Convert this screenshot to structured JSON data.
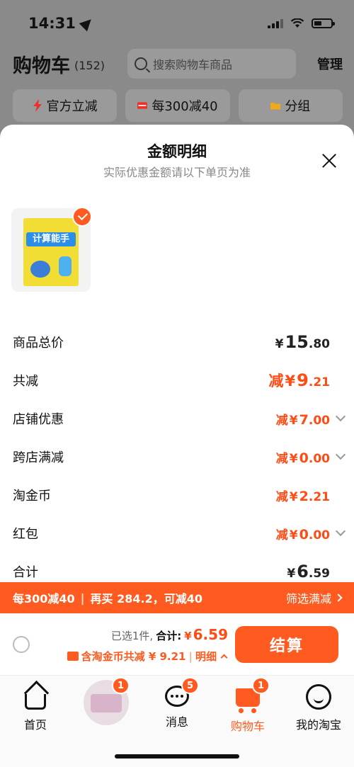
{
  "status": {
    "time": "14:31"
  },
  "header": {
    "title": "购物车",
    "count": "(152)",
    "search_placeholder": "搜索购物车商品",
    "manage": "管理"
  },
  "chips": [
    {
      "icon": "lightning-icon",
      "label": "官方立减",
      "color": "#e8322a"
    },
    {
      "icon": "coupon-icon",
      "label": "每300减40",
      "color": "#e8322a"
    },
    {
      "icon": "folder-icon",
      "label": "分组",
      "color": "#f2a818"
    }
  ],
  "sheet": {
    "title": "金额明细",
    "subtitle": "实际优惠金额请以下单页为准",
    "product_cover_text": "计算能手",
    "rows": [
      {
        "label": "商品总价",
        "prefix": "",
        "yen": "¥",
        "int": "15",
        "dec": ".80",
        "style": "dark",
        "chevron": false
      },
      {
        "label": "共减",
        "prefix": "减",
        "yen": "¥",
        "int": "9",
        "dec": ".21",
        "style": "orange",
        "chevron": false
      },
      {
        "label": "店铺优惠",
        "prefix": "减",
        "yen": "¥",
        "int": "7",
        "dec": ".00",
        "style": "orange-small",
        "chevron": true
      },
      {
        "label": "跨店满减",
        "prefix": "减",
        "yen": "¥",
        "int": "0",
        "dec": ".00",
        "style": "orange-small",
        "chevron": true
      },
      {
        "label": "淘金币",
        "prefix": "减",
        "yen": "¥",
        "int": "2",
        "dec": ".21",
        "style": "orange-small",
        "chevron": false
      },
      {
        "label": "红包",
        "prefix": "减",
        "yen": "¥",
        "int": "0",
        "dec": ".00",
        "style": "orange-small",
        "chevron": true
      },
      {
        "label": "合计",
        "prefix": "",
        "yen": "¥",
        "int": "6",
        "dec": ".59",
        "style": "dark",
        "chevron": false
      }
    ]
  },
  "promo": {
    "left": "每300减40",
    "middle": "再买 284.2，可减40",
    "right": "筛选满减"
  },
  "checkout": {
    "selected": "已选1件,",
    "total_label": "合计:",
    "yen": "¥",
    "total": "6.59",
    "savings": "含淘金币共减 ¥ 9.21",
    "detail": "明细",
    "pay": "结算"
  },
  "tabs": [
    {
      "label": "首页",
      "badge": ""
    },
    {
      "label": "",
      "badge": "1"
    },
    {
      "label": "消息",
      "badge": "5"
    },
    {
      "label": "购物车",
      "badge": "1",
      "active": true
    },
    {
      "label": "我的淘宝",
      "badge": ""
    }
  ],
  "colors": {
    "accent": "#ff5a1f",
    "price_orange": "#ff4b14"
  }
}
